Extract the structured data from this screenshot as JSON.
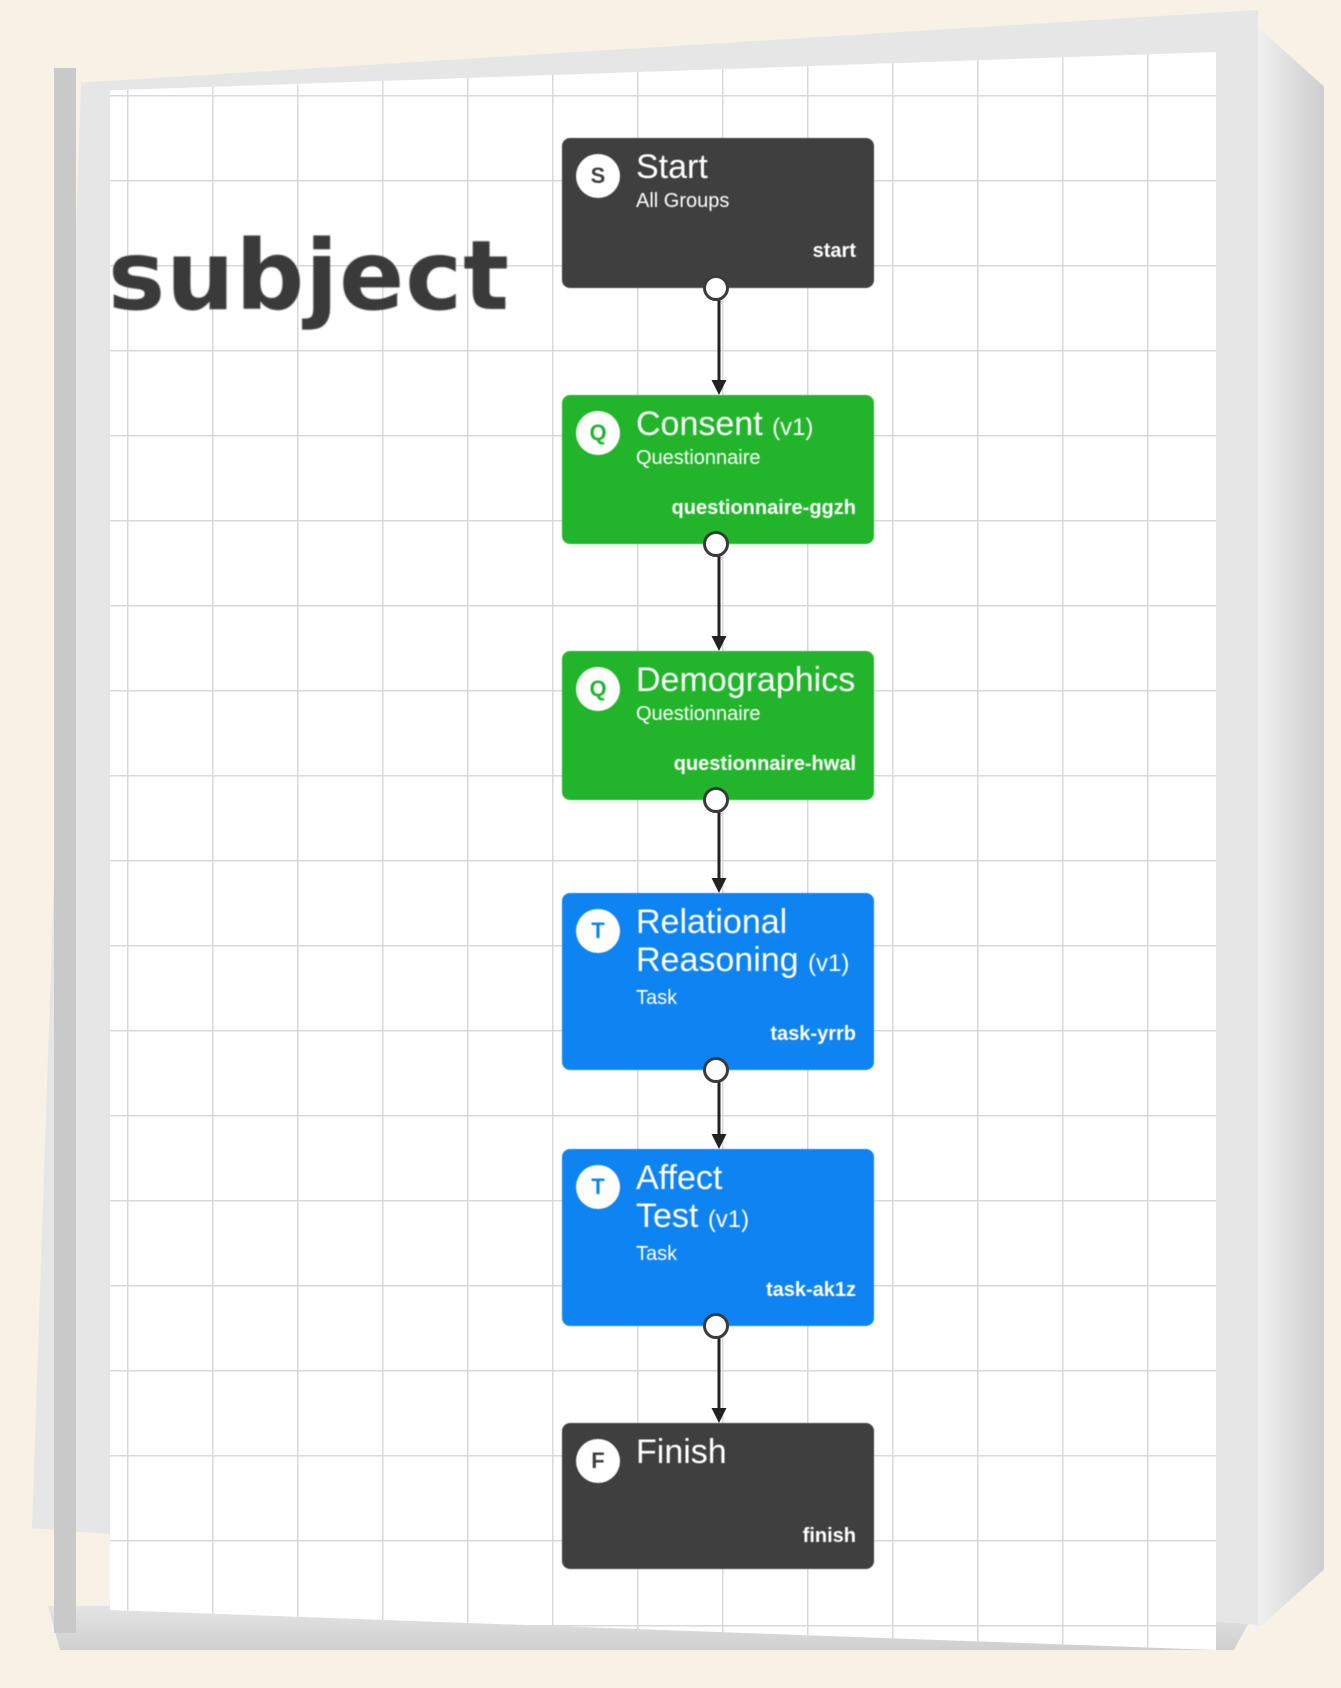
{
  "page_title": "subject",
  "nodes": [
    {
      "badge": "S",
      "title": "Start",
      "version": "",
      "subtitle": "All Groups",
      "id": "start"
    },
    {
      "badge": "Q",
      "title": "Consent",
      "version": "(v1)",
      "subtitle": "Questionnaire",
      "id": "questionnaire-ggzh"
    },
    {
      "badge": "Q",
      "title": "Demographics",
      "version": "",
      "subtitle": "Questionnaire",
      "id": "questionnaire-hwal"
    },
    {
      "badge": "T",
      "title": "Relational\nReasoning",
      "version": "(v1)",
      "subtitle": "Task",
      "id": "task-yrrb"
    },
    {
      "badge": "T",
      "title": "Affect\nTest",
      "version": "(v1)",
      "subtitle": "Task",
      "id": "task-ak1z"
    },
    {
      "badge": "F",
      "title": "Finish",
      "version": "",
      "subtitle": "",
      "id": "finish"
    }
  ]
}
